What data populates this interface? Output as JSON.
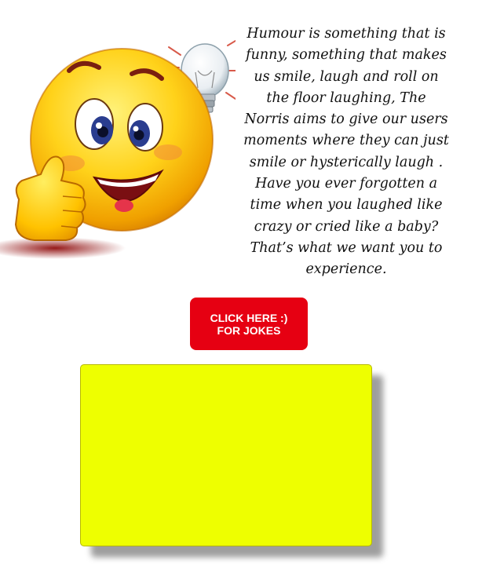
{
  "intro": {
    "text": "Humour is something that is funny, something that makes us smile, laugh and roll on the floor laughing, The Norris aims to give our users moments where they can just smile or hysterically laugh . Have you ever forgotten a time when you laughed like crazy or cried like a baby? That’s what we want you to experience."
  },
  "hero": {
    "emoji_icon": "thumbs-up-idea-emoji-icon"
  },
  "cta": {
    "label": "CLICK HERE :) FOR JOKES",
    "bg_color": "#e60012",
    "text_color": "#ffffff"
  },
  "joke_panel": {
    "bg_color": "#eeff00"
  }
}
